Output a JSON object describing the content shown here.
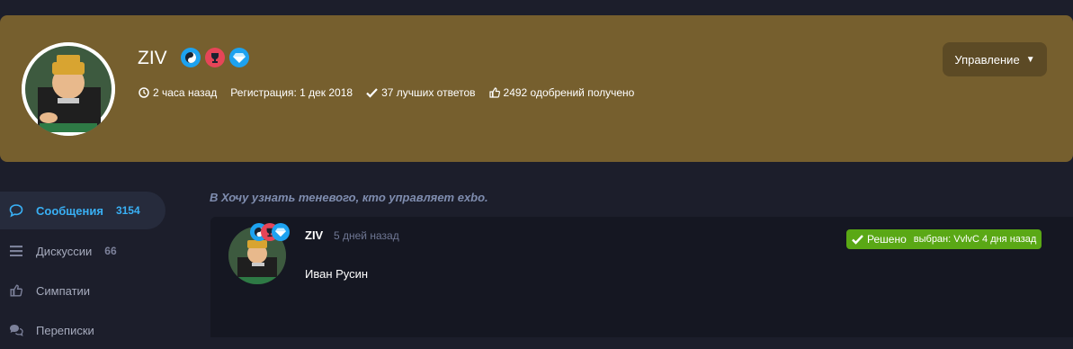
{
  "profile": {
    "username": "ZIV",
    "badges": [
      {
        "icon": "yin-yang-icon",
        "color": "#1da2f0"
      },
      {
        "icon": "trophy-icon",
        "color": "#e64558"
      },
      {
        "icon": "diamond-icon",
        "color": "#1da2f0"
      }
    ],
    "last_seen": "2 часа назад",
    "registration": "Регистрация: 1 дек 2018",
    "best_answers": "37 лучших ответов",
    "likes": "2492 одобрений получено",
    "manage_label": "Управление"
  },
  "sidebar": {
    "items": [
      {
        "label": "Сообщения",
        "count": "3154",
        "icon": "comment-icon",
        "active": true
      },
      {
        "label": "Дискуссии",
        "count": "66",
        "icon": "list-icon",
        "active": false
      },
      {
        "label": "Симпатии",
        "count": "",
        "icon": "thumbs-up-icon",
        "active": false
      },
      {
        "label": "Переписки",
        "count": "",
        "icon": "chat-icon",
        "active": false
      }
    ]
  },
  "thread": {
    "prefix": "В",
    "title": "Хочу узнать теневого, кто управляет exbo."
  },
  "post": {
    "author": "ZIV",
    "time": "5 дней назад",
    "body": "Иван Русин",
    "solved_label": "Решено",
    "solved_by": "выбран: VvlvC 4 дня назад"
  },
  "colors": {
    "page_bg": "#1c1e2b",
    "hero_bg": "#765f2e",
    "accent": "#39b0f5",
    "solved": "#5aa815"
  }
}
